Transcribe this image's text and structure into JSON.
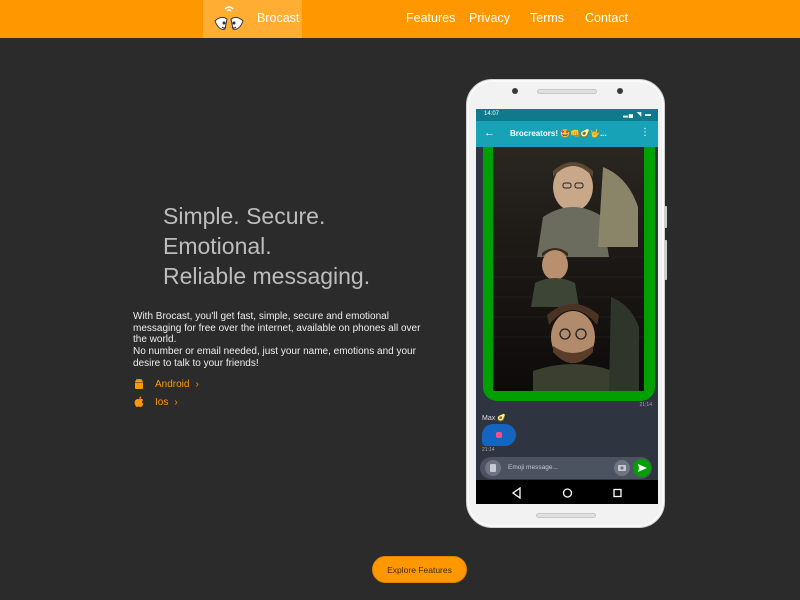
{
  "header": {
    "brand_name": "Brocast",
    "links": [
      "Features",
      "Privacy",
      "Terms",
      "Contact"
    ]
  },
  "hero": {
    "title_lines": [
      "Simple. Secure.",
      "Emotional.",
      "Reliable messaging."
    ],
    "description_line1": "With Brocast, you'll get fast, simple, secure and emotional messaging for free over the internet, available on phones all over the world.",
    "description_line2": "No number or email needed, just your name, emotions and your desire to talk to your friends!",
    "stores": [
      {
        "label": "Android",
        "icon": "android-icon"
      },
      {
        "label": "Ios",
        "icon": "apple-icon"
      }
    ]
  },
  "cta": {
    "explore_label": "Explore Features"
  },
  "phone": {
    "status_time": "14:07",
    "chat_title": "Brocreators! 🤩👊🥑🤟...",
    "photo_time": "21:14",
    "sender_name": "Max 🥑",
    "bubble_time": "21:14",
    "compose_placeholder": "Emoji message..."
  },
  "colors": {
    "accent": "#ff9800",
    "background": "#2b2b2b",
    "chat_header": "#17a2b8",
    "photo_border": "#00a000",
    "bubble": "#1565c0"
  }
}
